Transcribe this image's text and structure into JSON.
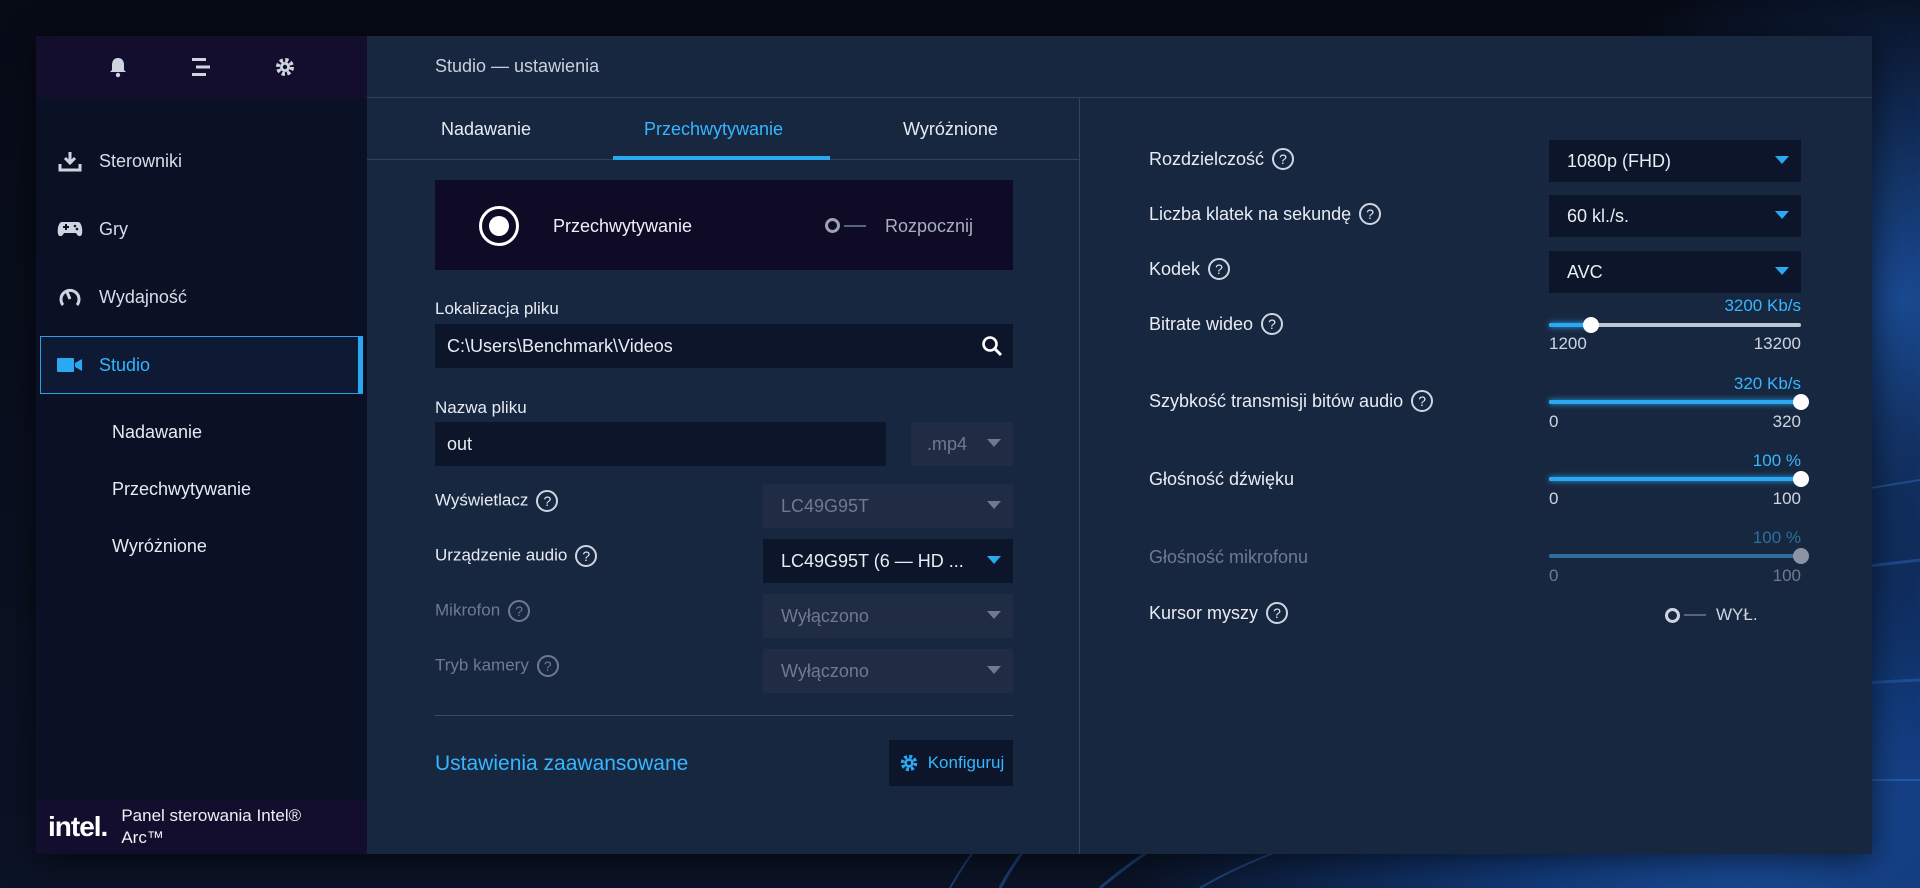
{
  "header": {
    "title": "Studio — ustawienia"
  },
  "sidebar": {
    "items": [
      {
        "label": "Sterowniki"
      },
      {
        "label": "Gry"
      },
      {
        "label": "Wydajność"
      },
      {
        "label": "Studio"
      }
    ],
    "sub_items": [
      {
        "label": "Nadawanie"
      },
      {
        "label": "Przechwytywanie"
      },
      {
        "label": "Wyróżnione"
      }
    ],
    "brand": {
      "logo_text": "intel.",
      "line1": "Panel sterowania Intel®",
      "line2": "Arc™"
    }
  },
  "tabs": [
    {
      "label": "Nadawanie"
    },
    {
      "label": "Przechwytywanie"
    },
    {
      "label": "Wyróżnione"
    }
  ],
  "capture": {
    "mode_label": "Przechwytywanie",
    "toggle_label": "Rozpocznij"
  },
  "file": {
    "location_label": "Lokalizacja pliku",
    "location_value": "C:\\Users\\Benchmark\\Videos",
    "name_label": "Nazwa pliku",
    "name_value": "out",
    "extension": ".mp4"
  },
  "left_settings": {
    "display_label": "Wyświetlacz",
    "display_value": "LC49G95T",
    "audio_label": "Urządzenie audio",
    "audio_value": "LC49G95T (6 — HD ...",
    "mic_label": "Mikrofon",
    "mic_value": "Wyłączono",
    "camera_label": "Tryb kamery",
    "camera_value": "Wyłączono"
  },
  "advanced": {
    "link": "Ustawienia zaawansowane",
    "configure_button": "Konfiguruj"
  },
  "right_settings": {
    "resolution_label": "Rozdzielczość",
    "resolution_value": "1080p (FHD)",
    "fps_label": "Liczba klatek na sekundę",
    "fps_value": "60 kl./s.",
    "codec_label": "Kodek",
    "codec_value": "AVC",
    "video_bitrate": {
      "label": "Bitrate wideo",
      "value_text": "3200 Kb/s",
      "min": "1200",
      "max": "13200",
      "value": 3200,
      "range": [
        1200,
        13200
      ]
    },
    "audio_bitrate": {
      "label": "Szybkość transmisji bitów audio",
      "value_text": "320 Kb/s",
      "min": "0",
      "max": "320",
      "value": 320,
      "range": [
        0,
        320
      ]
    },
    "volume": {
      "label": "Głośność dźwięku",
      "value_text": "100 %",
      "min": "0",
      "max": "100",
      "value": 100,
      "range": [
        0,
        100
      ]
    },
    "mic_volume": {
      "label": "Głośność mikrofonu",
      "value_text": "100 %",
      "min": "0",
      "max": "100",
      "value": 100,
      "range": [
        0,
        100
      ]
    },
    "cursor_label": "Kursor myszy",
    "cursor_state": "WYŁ."
  },
  "help_glyph": "?",
  "colors": {
    "accent": "#2aa8f2",
    "sidebar_bg": "#0b1124",
    "panel_bg": "#182740"
  }
}
